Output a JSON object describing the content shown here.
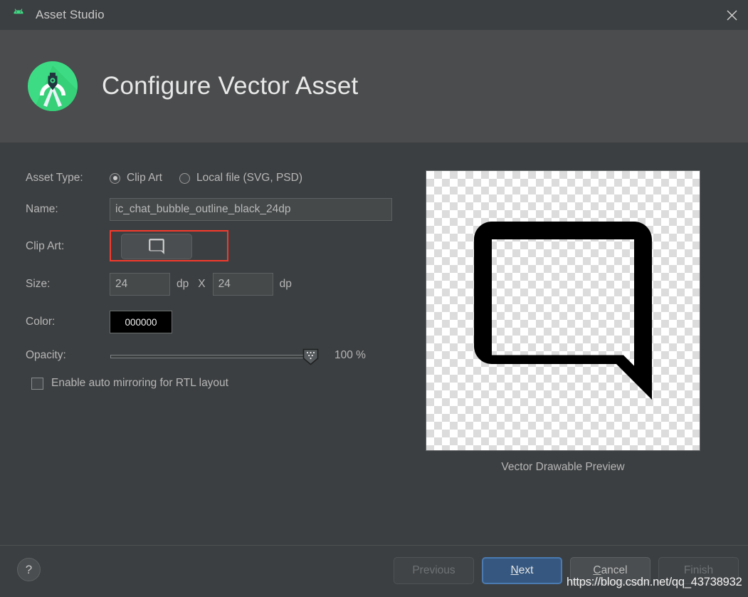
{
  "window": {
    "title": "Asset Studio",
    "app_icon": "android-head-icon",
    "close_icon": "close-icon"
  },
  "header": {
    "title": "Configure Vector Asset",
    "logo": "android-studio-logo"
  },
  "form": {
    "asset_type": {
      "label": "Asset Type:",
      "options": [
        {
          "label": "Clip Art",
          "selected": true
        },
        {
          "label": "Local file (SVG, PSD)",
          "selected": false
        }
      ]
    },
    "name": {
      "label": "Name:",
      "value": "ic_chat_bubble_outline_black_24dp",
      "placeholder": ""
    },
    "clip_art": {
      "label": "Clip Art:",
      "icon": "chat-bubble-outline-icon",
      "highlighted": true,
      "highlight_color": "#f6392c"
    },
    "size": {
      "label": "Size:",
      "width": "24",
      "height": "24",
      "unit": "dp",
      "separator": "X"
    },
    "color": {
      "label": "Color:",
      "value": "000000",
      "swatch_hex": "#000000"
    },
    "opacity": {
      "label": "Opacity:",
      "value": "100 %",
      "percent": 100
    },
    "rtl": {
      "label": "Enable auto mirroring for RTL layout",
      "checked": false
    }
  },
  "preview": {
    "caption": "Vector Drawable Preview",
    "icon": "chat-bubble-outline-icon"
  },
  "footer": {
    "help_label": "?",
    "buttons": [
      {
        "name": "previous",
        "label": "Previous",
        "state": "disabled",
        "mnemonic": ""
      },
      {
        "name": "next",
        "label": "Next",
        "state": "primary",
        "mnemonic": "N"
      },
      {
        "name": "cancel",
        "label": "Cancel",
        "state": "normal",
        "mnemonic": "C"
      },
      {
        "name": "finish",
        "label": "Finish",
        "state": "disabled",
        "mnemonic": ""
      }
    ]
  },
  "watermark": {
    "text": "https://blog.csdn.net/qq_43738932"
  }
}
